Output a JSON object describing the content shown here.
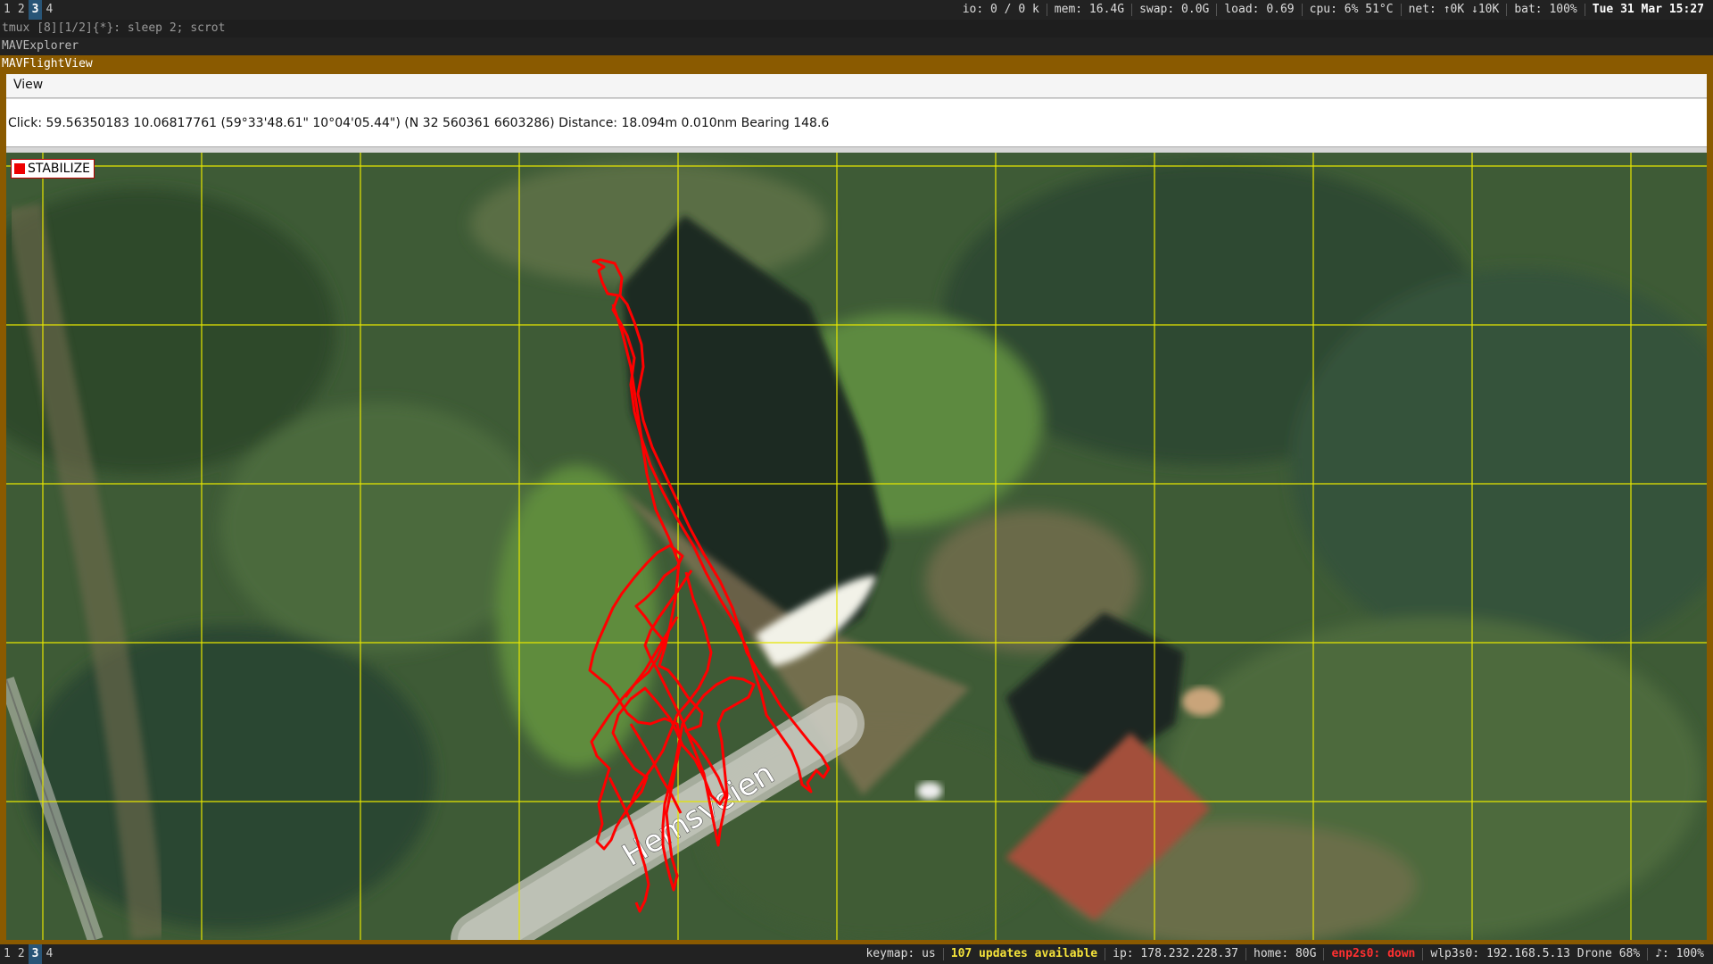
{
  "top_bar": {
    "workspaces": [
      "1",
      "2",
      "3",
      "4"
    ],
    "active_workspace": "3",
    "status": [
      {
        "text": "io: 0   /   0 k",
        "style": "normal"
      },
      {
        "text": "mem: 16.4G",
        "style": "normal"
      },
      {
        "text": "swap: 0.0G",
        "style": "normal"
      },
      {
        "text": "load: 0.69",
        "style": "normal"
      },
      {
        "text": "cpu:   6%   51°C",
        "style": "normal"
      },
      {
        "text": "net:   ↑0K  ↓10K",
        "style": "normal"
      },
      {
        "text": "bat: 100%",
        "style": "normal"
      },
      {
        "text": "Tue 31 Mar 15:27",
        "style": "bold"
      }
    ]
  },
  "windows": {
    "tmux_title": "tmux [8][1/2]{*}:  sleep 2; scrot",
    "explorer_title": "MAVExplorer",
    "flightview_title": "MAVFlightView"
  },
  "app": {
    "menu": [
      "View"
    ],
    "info_text": "Click: 59.56350183 10.06817761 (59°33'48.61\" 10°04'05.44\") (N 32 560361 6603286)  Distance: 18.094m 0.010nm Bearing 148.6",
    "mode_label": "STABILIZE",
    "mode_color": "#e00000",
    "road_label": "Hemsveien",
    "track_color": "#ff0000",
    "grid_color": "#e6e600"
  },
  "bottom_bar": {
    "workspaces": [
      "1",
      "2",
      "3",
      "4"
    ],
    "active_workspace": "3",
    "status": [
      {
        "text": "keymap: us",
        "style": "normal"
      },
      {
        "text": "107 updates available",
        "style": "yellow"
      },
      {
        "text": "ip: 178.232.228.37",
        "style": "normal"
      },
      {
        "text": "home: 80G",
        "style": "normal"
      },
      {
        "text": "enp2s0: down",
        "style": "red"
      },
      {
        "text": "wlp3s0: 192.168.5.13  Drone  68%",
        "style": "normal"
      },
      {
        "text": "♪: 100%",
        "style": "normal"
      }
    ]
  }
}
